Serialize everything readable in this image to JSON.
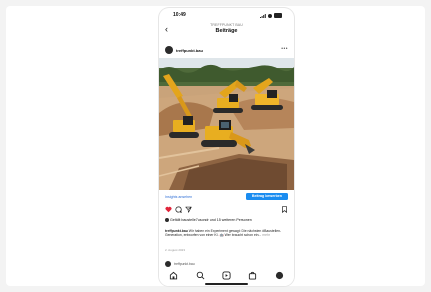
{
  "status_bar": {
    "time": "10:49"
  },
  "nav": {
    "subtitle": "TREFFPUNKT BAU",
    "title": "Beiträge"
  },
  "post": {
    "account": "treffpunkt.bau",
    "insights_label": "Insights ansehen",
    "boost_label": "Beitrag bewerben",
    "likes_text": "Gefällt baustelle7usondr und 15 weiteren Personen",
    "caption_account": "treffpunkt.bau",
    "caption_text": "Wir haben ein Experiment gewagt: Die nächsten #Baustellen-Generation, entworfen von einer KI. 🤖 Wer braucht schon ein...",
    "caption_more": "mehr",
    "date": "2. August 2023"
  },
  "next_post": {
    "account": "treffpunkt.bau"
  },
  "colors": {
    "accent": "#1a8cf0",
    "like": "#e0243a",
    "link": "#2f6fd6"
  },
  "icons": {
    "back": "chevron-left-icon",
    "more": "ellipsis-icon",
    "like": "heart-icon",
    "comment": "comment-icon",
    "share": "send-icon",
    "save": "bookmark-icon",
    "tabs": [
      "home-icon",
      "search-icon",
      "reels-icon",
      "shop-icon",
      "profile-icon"
    ]
  }
}
